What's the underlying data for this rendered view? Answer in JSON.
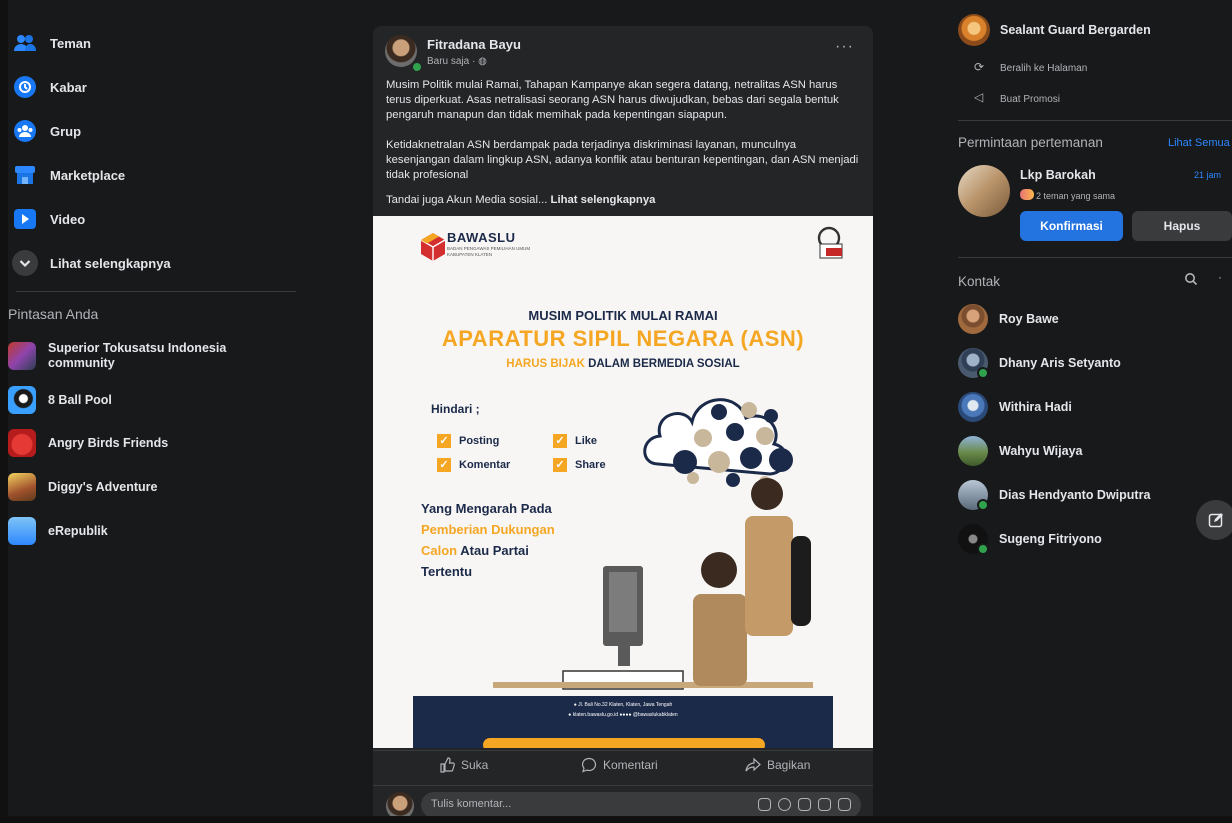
{
  "sidebar": {
    "items": [
      {
        "label": "Teman",
        "icon": "friends-icon"
      },
      {
        "label": "Kabar",
        "icon": "memories-icon"
      },
      {
        "label": "Grup",
        "icon": "groups-icon"
      },
      {
        "label": "Marketplace",
        "icon": "marketplace-icon"
      },
      {
        "label": "Video",
        "icon": "video-icon"
      },
      {
        "label": "Lihat selengkapnya",
        "icon": "chevron-down-icon"
      }
    ],
    "shortcuts_title": "Pintasan Anda",
    "shortcuts": [
      {
        "label": "Superior Tokusatsu Indonesia community"
      },
      {
        "label": "8 Ball Pool"
      },
      {
        "label": "Angry Birds Friends"
      },
      {
        "label": "Diggy's Adventure"
      },
      {
        "label": "eRepublik"
      }
    ]
  },
  "post": {
    "author": "Fitradana Bayu",
    "time": "Baru saja · ",
    "more": "···",
    "paragraphs": [
      "Musim Politik mulai Ramai, Tahapan Kampanye akan segera datang, netralitas ASN harus terus diperkuat. Asas netralisasi seorang ASN harus diwujudkan, bebas dari segala bentuk pengaruh manapun dan tidak memihak pada kepentingan siapapun.",
      "Ketidaknetralan ASN berdampak pada terjadinya diskriminasi layanan, munculnya kesenjangan dalam lingkup ASN, adanya konflik atau benturan kepentingan, dan ASN menjadi tidak profesional"
    ],
    "tag_line": "Tandai juga Akun Media sosial... ",
    "see_more": "Lihat selengkapnya",
    "poster": {
      "org": "BAWASLU",
      "org_sub": "BADAN PENGAWAS PEMILIHAN UMUM",
      "org_sub2": "KABUPATEN KLATEN",
      "line1": "MUSIM POLITIK MULAI RAMAI",
      "line2": "APARATUR SIPIL NEGARA (ASN)",
      "line3a": "HARUS BIJAK",
      "line3b": " DALAM BERMEDIA SOSIAL",
      "avoid": "Hindari ;",
      "checks": [
        "Posting",
        "Like",
        "Komentar",
        "Share"
      ],
      "body1": "Yang Mengarah Pada",
      "body2": "Pemberian Dukungan",
      "body3a": "Calon",
      "body3b": " Atau Partai",
      "body4": "Tertentu",
      "footer1": "Jl. Bali No.32 Klaten, Klaten, Jawa Tengah",
      "footer2": "klaten.bawaslu.go.id",
      "footer3": "@bawaslukabklaten"
    },
    "actions": {
      "like": "Suka",
      "comment": "Komentari",
      "share": "Bagikan"
    },
    "comment_placeholder": "Tulis komentar..."
  },
  "right": {
    "page_name": "Sealant Guard Bergarden",
    "switch_page": "Beralih ke Halaman",
    "promote": "Buat Promosi",
    "friend_requests_title": "Permintaan pertemanan",
    "see_all": "Lihat Semua",
    "request": {
      "name": "Lkp Barokah",
      "time": "21 jam",
      "mutual": "2 teman yang sama",
      "confirm": "Konfirmasi",
      "delete": "Hapus"
    },
    "contacts_title": "Kontak",
    "contacts": [
      {
        "name": "Roy Bawe",
        "online": false
      },
      {
        "name": "Dhany Aris Setyanto",
        "online": true
      },
      {
        "name": "Withira Hadi",
        "online": false
      },
      {
        "name": "Wahyu Wijaya",
        "online": false
      },
      {
        "name": "Dias Hendyanto Dwiputra",
        "online": true
      },
      {
        "name": "Sugeng Fitriyono",
        "online": true
      }
    ]
  },
  "colors": {
    "accent": "#2374e1",
    "bg": "#18191a",
    "card": "#242526",
    "poster_orange": "#f5a623",
    "poster_navy": "#1c2a4a"
  }
}
